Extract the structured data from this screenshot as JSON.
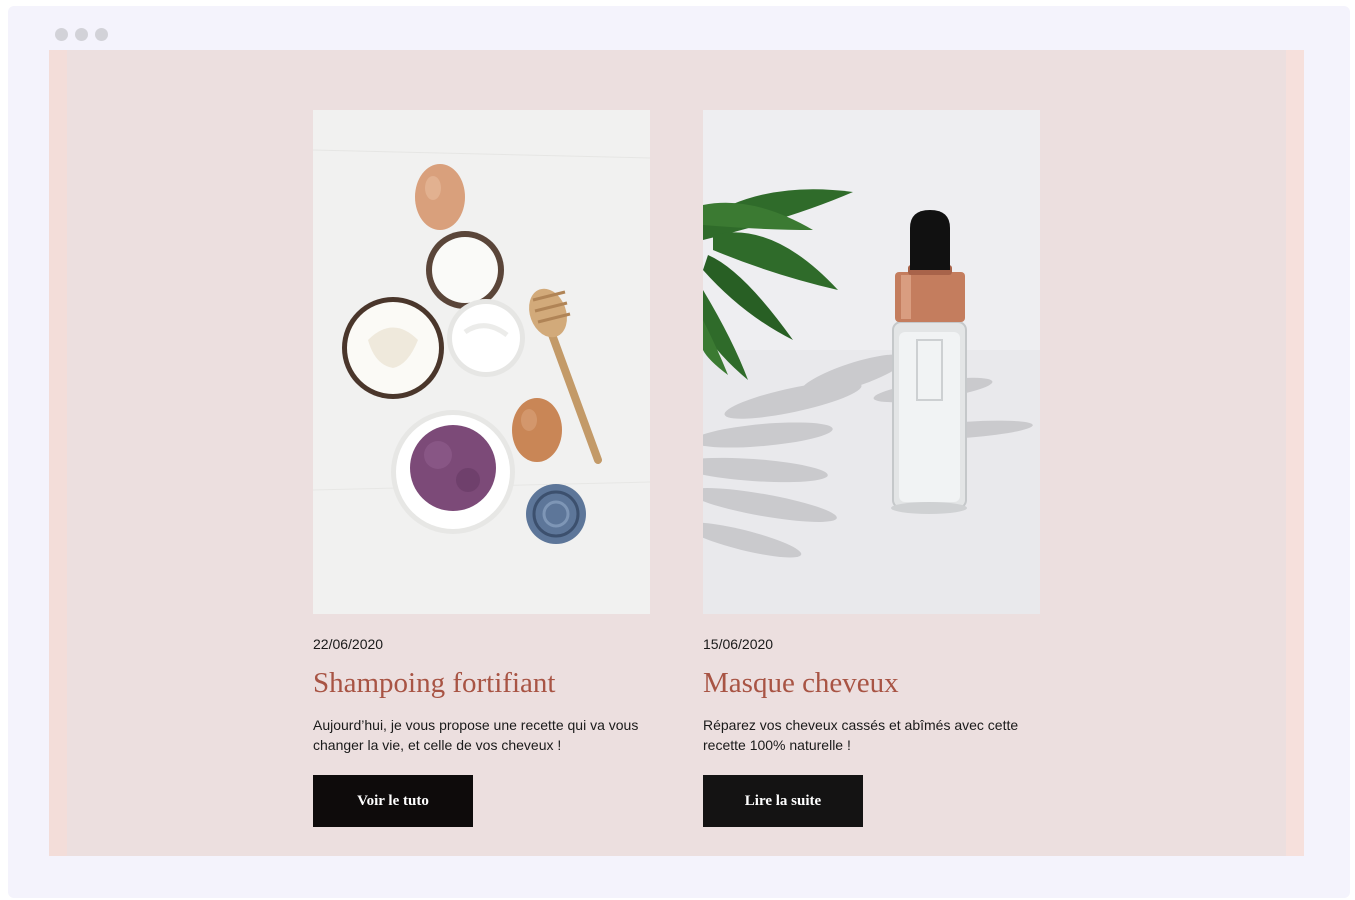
{
  "window": {
    "controls": [
      "dot",
      "dot",
      "dot"
    ]
  },
  "posts": [
    {
      "date": "22/06/2020",
      "title": "Shampoing fortifiant",
      "description": "Aujourd’hui, je vous propose une recette qui va vous changer la vie, et celle de vos cheveux !",
      "button_label": "Voir le tuto"
    },
    {
      "date": "15/06/2020",
      "title": "Masque cheveux",
      "description": "Réparez vos cheveux cassés et abîmés avec cette recette 100% naturelle !",
      "button_label": "Lire la suite"
    }
  ],
  "colors": {
    "frame_bg": "#f4f3fc",
    "page_bg": "#ecdfdf",
    "title_accent": "#a85444",
    "button_bg": "#0e0b0b",
    "button_text": "#ffffff"
  }
}
